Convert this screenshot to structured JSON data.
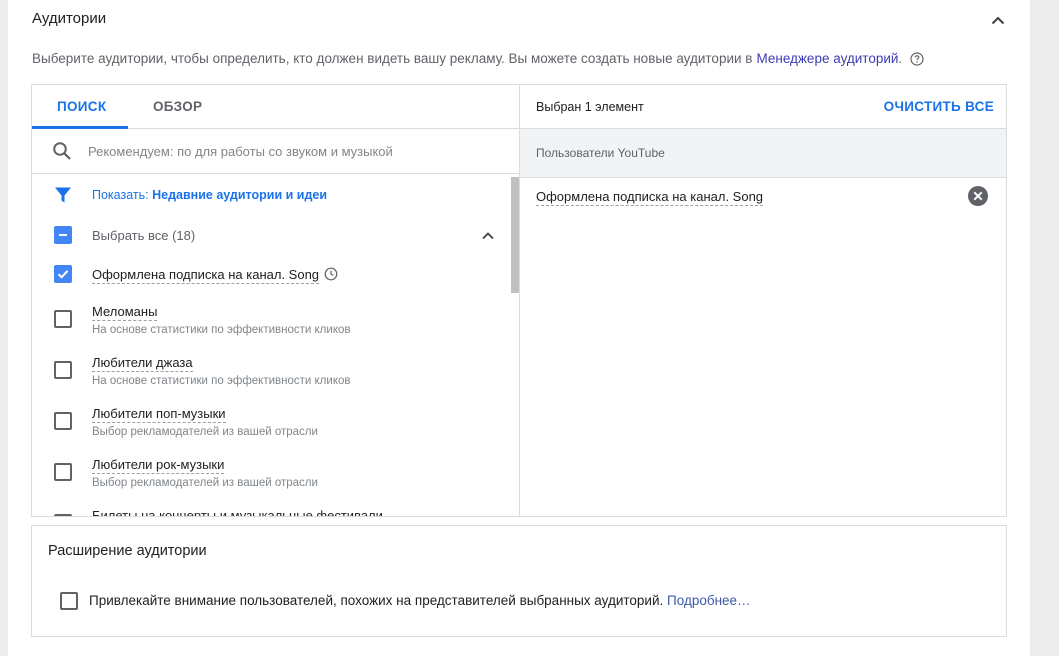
{
  "section": {
    "title": "Аудитории",
    "description": "Выберите аудитории, чтобы определить, кто должен видеть вашу рекламу. Вы можете создать новые аудитории в",
    "manager_link": "Менеджере аудиторий",
    "manager_link_tail": "."
  },
  "tabs": [
    {
      "label": "ПОИСК",
      "active": true
    },
    {
      "label": "ОБЗОР",
      "active": false
    }
  ],
  "search": {
    "placeholder": "Рекомендуем: по для работы со звуком и музыкой",
    "value": ""
  },
  "filter": {
    "prefix": "Показать:",
    "value": "Недавние аудитории и идеи"
  },
  "select_all": {
    "label": "Выбрать все (18)"
  },
  "items": [
    {
      "title": "Оформлена подписка на канал. Song",
      "subtitle": "",
      "checked": true,
      "recent": true
    },
    {
      "title": "Меломаны",
      "subtitle": "На основе статистики по эффективности кликов",
      "checked": false,
      "recent": false
    },
    {
      "title": "Любители джаза",
      "subtitle": "На основе статистики по эффективности кликов",
      "checked": false,
      "recent": false
    },
    {
      "title": "Любители поп-музыки",
      "subtitle": "Выбор рекламодателей из вашей отрасли",
      "checked": false,
      "recent": false
    },
    {
      "title": "Любители рок-музыки",
      "subtitle": "Выбор рекламодателей из вашей отрасли",
      "checked": false,
      "recent": false
    },
    {
      "title": "Билеты на концерты и музыкальные фестивали",
      "subtitle": "",
      "checked": false,
      "recent": false
    }
  ],
  "selected_panel": {
    "count_label": "Выбран 1 элемент",
    "clear_all": "ОЧИСТИТЬ ВСЕ",
    "group": "Пользователи YouTube",
    "selected_items": [
      "Оформлена подписка на канал. Song"
    ]
  },
  "expansion": {
    "title": "Расширение аудитории",
    "checkbox_label": "Привлекайте внимание пользователей, похожих на представителей выбранных аудиторий.",
    "more_link": "Подробнее…",
    "checked": false
  },
  "colors": {
    "accent": "#1a73e8",
    "checkbox_checked": "#4285f4",
    "link": "#3c3cb4"
  }
}
